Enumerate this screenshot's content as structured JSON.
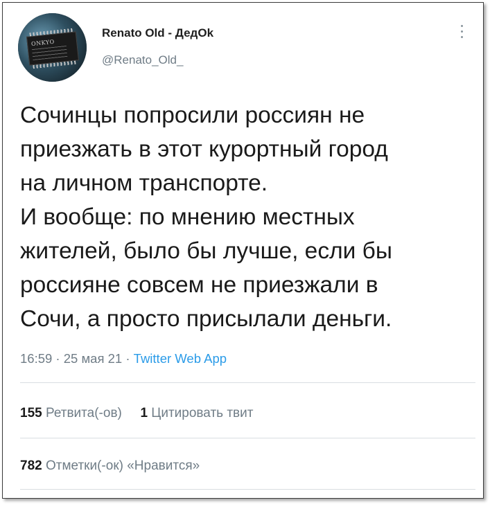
{
  "author": {
    "name": "Renato Old - ДедOk",
    "handle": "@Renato_Old_",
    "avatar_icon": "ic-chip-avatar",
    "avatar_chip_text": "ONKYO"
  },
  "tweet": {
    "lines": [
      "Сочинцы попросили россиян не",
      "приезжать в этот курортный город",
      "на личном транспорте.",
      "И вообще: по мнению местных",
      "жителей, было бы лучше, если бы",
      "россияне совсем не приезжали в",
      "Сочи, а просто присылали деньги."
    ]
  },
  "meta": {
    "time": "16:59",
    "separator": " · ",
    "date": "25 мая 21",
    "source": "Twitter Web App"
  },
  "stats": {
    "retweets_count": "155",
    "retweets_label": "Ретвита(-ов)",
    "quotes_count": "1",
    "quotes_label": "Цитировать твит",
    "likes_count": "782",
    "likes_label": "Отметки(-ок) «Нравится»"
  },
  "colors": {
    "link": "#2a9be8",
    "secondary_text": "#6f7c86",
    "primary_text": "#1a1a1a"
  }
}
